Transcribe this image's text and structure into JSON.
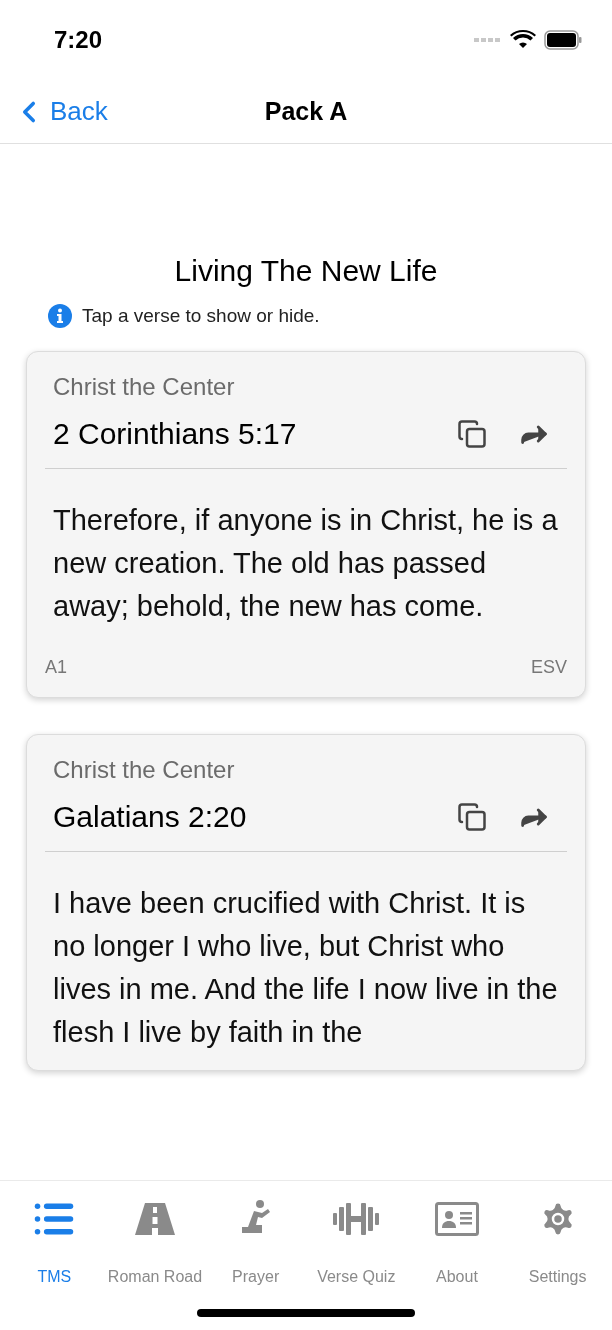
{
  "status_bar": {
    "time": "7:20"
  },
  "nav": {
    "back": "Back",
    "title": "Pack A"
  },
  "heading": "Living The New Life",
  "hint": "Tap a verse to show or hide.",
  "verses": [
    {
      "category": "Christ the Center",
      "reference": "2 Corinthians 5:17",
      "text": "Therefore, if anyone is in Christ, he is a new creation. The old has passed away; behold, the new has come.",
      "code": "A1",
      "translation": "ESV"
    },
    {
      "category": "Christ the Center",
      "reference": "Galatians 2:20",
      "text": "I have been crucified with Christ. It is no longer I who live, but Christ who lives in me. And the life I now live in the flesh I live by faith in the"
    }
  ],
  "tabs": [
    {
      "kind": "list",
      "label": "TMS",
      "selected": true
    },
    {
      "kind": "road",
      "label": "Roman Road",
      "selected": false
    },
    {
      "kind": "prayer",
      "label": "Prayer",
      "selected": false
    },
    {
      "kind": "dumbbell",
      "label": "Verse Quiz",
      "selected": false
    },
    {
      "kind": "card",
      "label": "About",
      "selected": false
    },
    {
      "kind": "gear",
      "label": "Settings",
      "selected": false
    }
  ]
}
